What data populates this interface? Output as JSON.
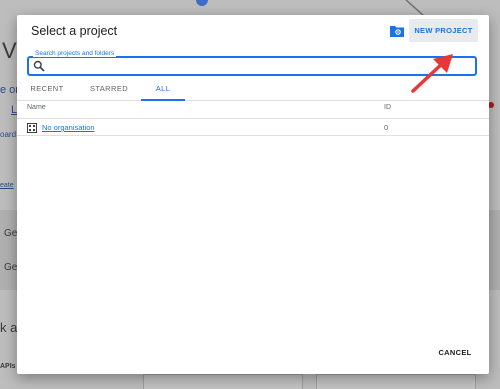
{
  "background": {
    "fragments": [
      {
        "text": "V",
        "style": "big"
      },
      {
        "text": "e or",
        "style": "link"
      },
      {
        "text": "L",
        "style": "link"
      },
      {
        "text": "oard",
        "style": "link"
      },
      {
        "text": "eate",
        "style": "link"
      },
      {
        "text": "Ge",
        "style": "text"
      },
      {
        "text": "Ge",
        "style": "text"
      },
      {
        "text": "k a",
        "style": "big"
      },
      {
        "text": "APIs",
        "style": "small"
      }
    ]
  },
  "dialog": {
    "title": "Select a project",
    "new_project_label": "NEW PROJECT",
    "search": {
      "label": "Search projects and folders",
      "value": ""
    },
    "tabs": [
      {
        "label": "RECENT",
        "active": false
      },
      {
        "label": "STARRED",
        "active": false
      },
      {
        "label": "ALL",
        "active": true
      }
    ],
    "table": {
      "columns": [
        "Name",
        "ID"
      ],
      "rows": [
        {
          "name": "No organisation",
          "id": "0"
        }
      ]
    },
    "cancel_label": "CANCEL"
  },
  "icons": {
    "folder_settings": "folder-settings-icon",
    "search": "search-icon",
    "organisation": "organisation-icon"
  },
  "colors": {
    "accent": "#1a73e8",
    "annotation_arrow": "#e53935",
    "overlay_background": "#bdbdbd"
  }
}
